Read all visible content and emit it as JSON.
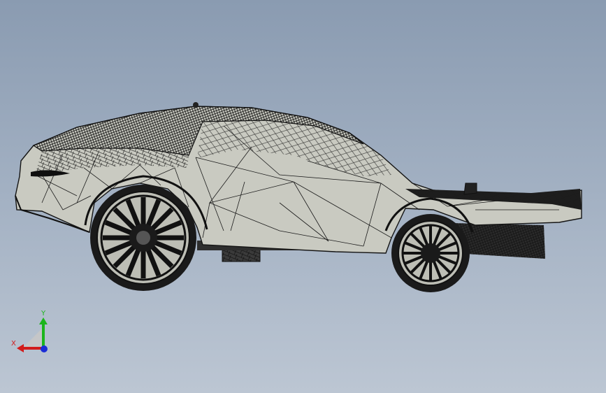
{
  "viewport": {
    "background_top": "#8a9bb1",
    "background_bottom": "#bcc6d3"
  },
  "model": {
    "kind": "car-wireframe-model",
    "shade": "#c9cac1",
    "edge_color": "#141414"
  },
  "triad": {
    "x_label": "X",
    "y_label": "Y",
    "x_color": "#d21b1b",
    "y_color": "#1cb51c",
    "z_color": "#1a2cd6"
  }
}
